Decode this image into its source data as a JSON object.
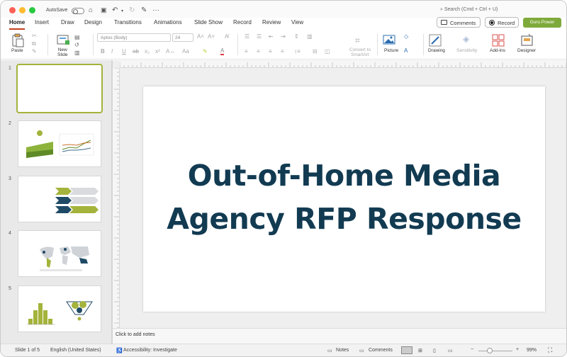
{
  "titlebar": {
    "autosave_label": "AutoSave",
    "search_placeholder": "Search (Cmd + Ctrl + U)"
  },
  "tabs": [
    "Home",
    "Insert",
    "Draw",
    "Design",
    "Transitions",
    "Animations",
    "Slide Show",
    "Record",
    "Review",
    "View"
  ],
  "active_tab": "Home",
  "actions": {
    "comments": "Comments",
    "record": "Record",
    "guru": "Guru Power",
    "guru_color": "#7eaa3b",
    "accent": "#c43e1c"
  },
  "ribbon": {
    "paste": "Paste",
    "new_slide_line1": "New",
    "new_slide_line2": "Slide",
    "font_name": "Aptos (Body)",
    "font_size": "24",
    "convert_line1": "Convert to",
    "convert_line2": "SmartArt",
    "picture": "Picture",
    "drawing": "Drawing",
    "sensitivity": "Sensitivity",
    "addins": "Add-ins",
    "designer": "Designer"
  },
  "thumbnails": [
    "1",
    "2",
    "3",
    "4",
    "5"
  ],
  "slide": {
    "title_line1": "Out-of-Home Media",
    "title_line2": "Agency RFP Response",
    "title_color": "#123b52"
  },
  "notes_placeholder": "Click to add notes",
  "status": {
    "slide_info": "Slide 1 of 5",
    "language": "English (United States)",
    "accessibility": "Accessibility: Investigate",
    "notes": "Notes",
    "comments": "Comments",
    "zoom": "99%"
  }
}
